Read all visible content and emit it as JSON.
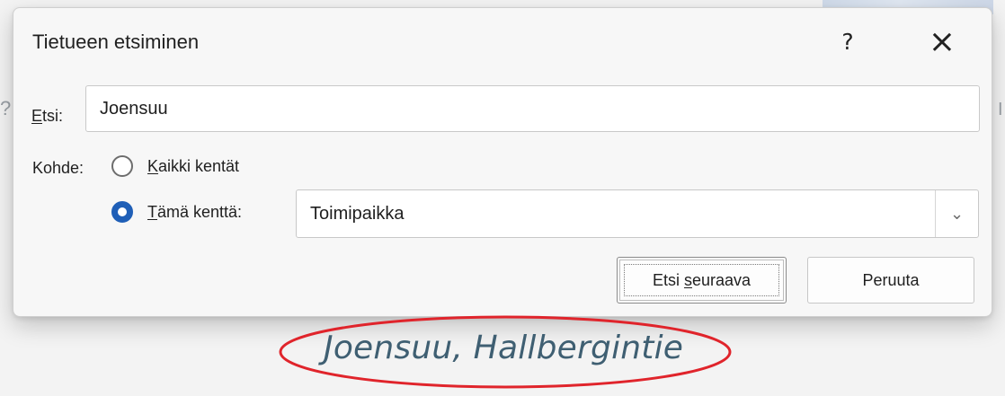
{
  "dialog": {
    "title": "Tietueen etsiminen",
    "help_symbol": "?",
    "close_symbol": "×",
    "search": {
      "label": "Etsi:",
      "label_parts": {
        "first": "E",
        "rest": "tsi:"
      },
      "value": "Joensuu"
    },
    "target": {
      "label": "Kohde:",
      "options": [
        {
          "label": "Kaikki kentät",
          "label_parts": {
            "first": "K",
            "rest": "aikki kentät"
          },
          "selected": false
        },
        {
          "label": "Tämä kenttä:",
          "label_parts": {
            "first": "T",
            "rest": "ämä kenttä:"
          },
          "selected": true
        }
      ],
      "field_value": "Toimipaikka",
      "dropdown_symbol": "⌄"
    },
    "buttons": {
      "next": {
        "label": "Etsi seuraava",
        "prefix": "Etsi ",
        "mnemonic": "s",
        "suffix": "euraava"
      },
      "cancel": {
        "label": "Peruuta"
      }
    }
  },
  "background": {
    "left_mark": "?",
    "right_mark": "I",
    "highlighted_note": "Joensuu, Hallbergintie"
  },
  "colors": {
    "accent": "#1f5fb7",
    "highlight_ellipse": "#e0242b",
    "note_text": "#3f5f72"
  }
}
